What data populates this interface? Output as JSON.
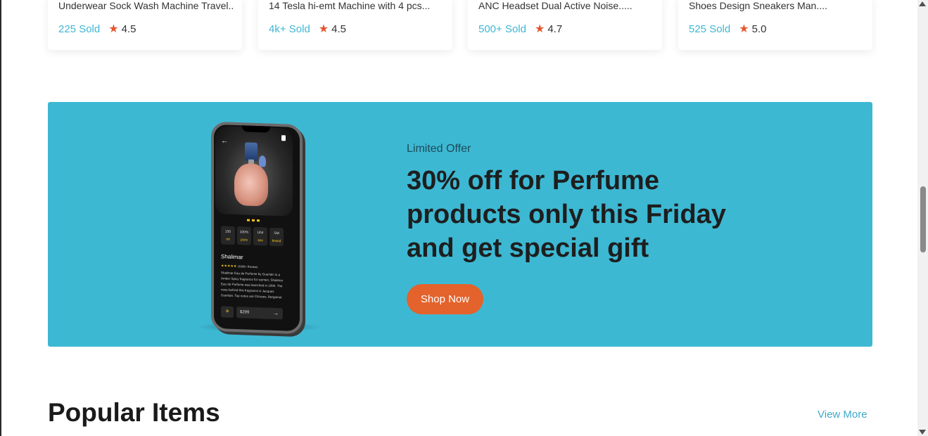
{
  "products": [
    {
      "title": "Underwear Sock Wash Machine Travel....",
      "sold": "225 Sold",
      "rating": "4.5"
    },
    {
      "title": "14 Tesla hi-emt Machine with 4 pcs...",
      "sold": "4k+ Sold",
      "rating": "4.5"
    },
    {
      "title": "ANC Headset Dual Active Noise.....",
      "sold": "500+ Sold",
      "rating": "4.7"
    },
    {
      "title": "Shoes Design Sneakers Man....",
      "sold": "525 Sold",
      "rating": "5.0"
    }
  ],
  "banner": {
    "label": "Limited Offer",
    "headline": "30% off for Perfume products only this Friday and get special gift",
    "button": "Shop Now",
    "background": "#3db8d3",
    "button_color": "#e4622b",
    "phone": {
      "specs": [
        {
          "value": "150",
          "key": "ml"
        },
        {
          "value": "100%",
          "key": "pure"
        },
        {
          "value": "UNI",
          "key": "sex"
        },
        {
          "value": "SM",
          "key": "brand"
        }
      ],
      "product_name": "Shalimar",
      "stars": "★★★★★",
      "reviews": "(1000+ Review)",
      "description": "Shalimar Eau de Perfume by Guerlain is a Amber Spicy fragrance for women. Shalimar Eau de Parfume was launched in 1990. The nose behind this fragrance is Jacques Guerlain. Top notes are Citruses, Bergamot",
      "plus": "+",
      "price": "$299",
      "arrow": "→",
      "back": "←"
    }
  },
  "popular": {
    "title": "Popular Items",
    "view_more": "View More"
  },
  "colors": {
    "sold": "#3fb6d3",
    "star": "#e4572e",
    "link": "#3fa9c7"
  },
  "icons": {
    "star": "★"
  }
}
